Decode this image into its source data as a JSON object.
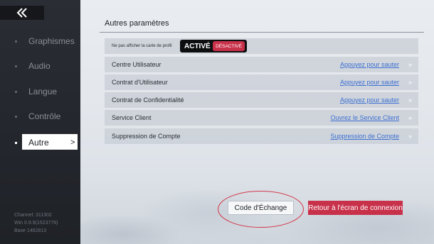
{
  "sidebar": {
    "back_icon": "back-arrow-icon",
    "items": [
      {
        "label": "Graphismes"
      },
      {
        "label": "Audio"
      },
      {
        "label": "Langue"
      },
      {
        "label": "Contrôle"
      },
      {
        "label": "Autre",
        "active": true
      }
    ],
    "active_chevron": ">",
    "version": {
      "channel": "Channel: 311302",
      "win": "Win 0.9.9(1523776)",
      "base": "Base 1462813"
    }
  },
  "main": {
    "title": "Autres paramètres",
    "profile_row": {
      "label": "Ne pas afficher la carte de profil",
      "toggle_on": "ACTIVÉ",
      "toggle_off": "DÉSACTIVÉ"
    },
    "rows": [
      {
        "label": "Centre Utilisateur",
        "link": "Appuyez pour sauter",
        "arrow": "»"
      },
      {
        "label": "Contrat d'Utilisateur",
        "link": "Appuyez pour sauter",
        "arrow": "»"
      },
      {
        "label": "Contrat de Confidentialité",
        "link": "Appuyez pour sauter",
        "arrow": "»"
      },
      {
        "label": "Service Client",
        "link": "Ouvrez le Service Client",
        "arrow": "»"
      },
      {
        "label": "Suppression de Compte",
        "link": "Suppression de Compte",
        "arrow": "»"
      }
    ]
  },
  "buttons": {
    "code": "Code d'Échange",
    "return": "Retour à l'écran de connexion"
  },
  "colors": {
    "accent_red": "#c8314a",
    "link_blue": "#3d6fd1",
    "sidebar_bg": "#23262c"
  }
}
